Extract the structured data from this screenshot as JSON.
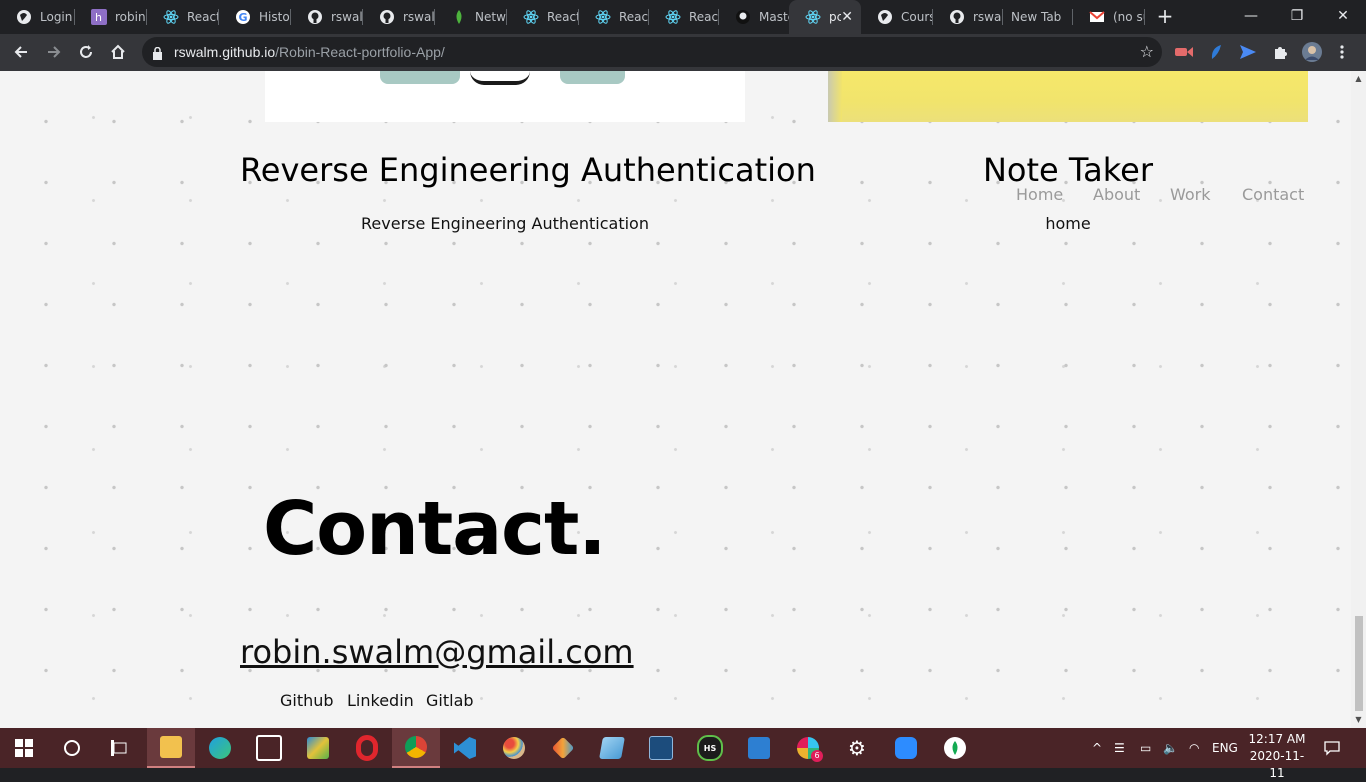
{
  "browser": {
    "tabs": [
      {
        "title": "Login",
        "icon": "globe-icon"
      },
      {
        "title": "robins",
        "icon": "heroku-icon"
      },
      {
        "title": "React",
        "icon": "react-icon"
      },
      {
        "title": "History",
        "icon": "google-icon"
      },
      {
        "title": "rswalm",
        "icon": "github-icon"
      },
      {
        "title": "rswalm",
        "icon": "github-icon"
      },
      {
        "title": "Netwo",
        "icon": "mongodb-leaf-icon"
      },
      {
        "title": "React",
        "icon": "react-icon"
      },
      {
        "title": "React",
        "icon": "react-icon"
      },
      {
        "title": "React",
        "icon": "react-icon"
      },
      {
        "title": "Maste",
        "icon": "github-icon"
      },
      {
        "title": "pc",
        "icon": "react-icon",
        "active": true
      },
      {
        "title": "Cours",
        "icon": "globe-icon"
      },
      {
        "title": "rswalm",
        "icon": "github-icon"
      },
      {
        "title": "New Tab",
        "icon": ""
      },
      {
        "title": "(no su",
        "icon": "gmail-icon"
      }
    ],
    "new_tab_symbol": "+",
    "window_controls": {
      "minimize": "—",
      "maximize": "❐",
      "close": "✕"
    },
    "address": {
      "domain": "rswalm.github.io",
      "path": "/Robin-React-portfolio-App/"
    }
  },
  "page": {
    "nav": [
      "Home",
      "About",
      "Work",
      "Contact"
    ],
    "projects": [
      {
        "title": "Reverse Engineering Authentication",
        "description": "Reverse Engineering Authentication"
      },
      {
        "title": "Note Taker",
        "description": "home"
      }
    ],
    "contact": {
      "heading": "Contact.",
      "email": "robin.swalm@gmail.com",
      "links": [
        "Github",
        "Linkedin",
        "Gitlab"
      ]
    }
  },
  "taskbar": {
    "apps": [
      "file-explorer-icon",
      "edge-icon",
      "snipping-tool-icon",
      "photo-app-icon",
      "opera-icon",
      "chrome-icon",
      "vscode-icon",
      "paint-icon",
      "git-icon",
      "notepad-icon",
      "mysql-workbench-icon",
      "hs-icon",
      "video-editor-icon",
      "slack-icon",
      "settings-icon",
      "zoom-icon",
      "mongodb-compass-icon"
    ],
    "slack_badge": "6",
    "hs_label": "HS",
    "language": "ENG",
    "time": "12:17 AM",
    "date": "2020-11-11"
  },
  "colors": {
    "tabstrip": "#202124",
    "toolbar": "#35363a",
    "taskbar": "#4a2427",
    "page_bg": "#f4f4f4"
  }
}
